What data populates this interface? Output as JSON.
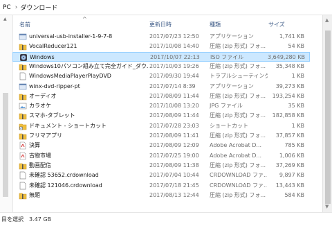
{
  "breadcrumb": {
    "items": [
      "PC",
      "ダウンロード"
    ],
    "separator": "›"
  },
  "columns": {
    "name": "名前",
    "date": "更新日時",
    "type": "種類",
    "size": "サイズ"
  },
  "rows": [
    {
      "name": "universal-usb-installer-1-9-7-8",
      "date": "2017/07/23 12:50",
      "type": "アプリケーション",
      "size": "1,741 KB",
      "icon": "app-icon"
    },
    {
      "name": "VocalReducer121",
      "date": "2017/10/08 14:40",
      "type": "圧縮 (zip 形式) フォ...",
      "size": "54 KB",
      "icon": "zip-icon"
    },
    {
      "name": "Windows",
      "date": "2017/10/07 22:13",
      "type": "ISO ファイル",
      "size": "3,649,280 KB",
      "icon": "iso-icon",
      "selected": true
    },
    {
      "name": "Windows10パソコン組み立て完全ガイド_ダウ...",
      "date": "2017/10/03 19:26",
      "type": "圧縮 (zip 形式) フォ...",
      "size": "35,348 KB",
      "icon": "zip-icon"
    },
    {
      "name": "WindowsMediaPlayerPlayDVD",
      "date": "2017/09/30 19:44",
      "type": "トラブルシューティング...",
      "size": "1 KB",
      "icon": "file-icon"
    },
    {
      "name": "winx-dvd-ripper-pt",
      "date": "2017/07/14 8:39",
      "type": "アプリケーション",
      "size": "39,273 KB",
      "icon": "app-icon"
    },
    {
      "name": "オーディオ",
      "date": "2017/08/09 11:44",
      "type": "圧縮 (zip 形式) フォ...",
      "size": "193,254 KB",
      "icon": "zip-icon"
    },
    {
      "name": "カラオケ",
      "date": "2017/10/08 13:20",
      "type": "JPG ファイル",
      "size": "35 KB",
      "icon": "image-icon"
    },
    {
      "name": "スマホ-タブレット",
      "date": "2017/08/09 11:44",
      "type": "圧縮 (zip 形式) フォ...",
      "size": "182,858 KB",
      "icon": "zip-icon"
    },
    {
      "name": "ドキュメント - ショートカット",
      "date": "2017/07/28 23:03",
      "type": "ショートカット",
      "size": "1 KB",
      "icon": "shortcut-icon"
    },
    {
      "name": "フリマアプリ",
      "date": "2017/08/09 11:41",
      "type": "圧縮 (zip 形式) フォ...",
      "size": "37,857 KB",
      "icon": "zip-icon"
    },
    {
      "name": "決算",
      "date": "2017/08/09 12:09",
      "type": "Adobe Acrobat D...",
      "size": "785 KB",
      "icon": "pdf-icon"
    },
    {
      "name": "古物市場",
      "date": "2017/07/25 19:00",
      "type": "Adobe Acrobat D...",
      "size": "1,006 KB",
      "icon": "pdf-icon"
    },
    {
      "name": "動画配信",
      "date": "2017/08/09 11:38",
      "type": "圧縮 (zip 形式) フォ...",
      "size": "37,269 KB",
      "icon": "zip-icon"
    },
    {
      "name": "未確認 53652.crdownload",
      "date": "2017/07/04 10:44",
      "type": "CRDOWNLOAD ファ...",
      "size": "9,897 KB",
      "icon": "file-icon"
    },
    {
      "name": "未確認 121046.crdownload",
      "date": "2017/07/18 21:45",
      "type": "CRDOWNLOAD ファ...",
      "size": "13,443 KB",
      "icon": "file-icon"
    },
    {
      "name": "無題",
      "date": "2017/08/13 12:44",
      "type": "圧縮 (zip 形式) フォ...",
      "size": "584 KB",
      "icon": "zip-icon"
    }
  ],
  "status": {
    "text": "目を選択",
    "size": "3.47 GB"
  },
  "colors": {
    "selection": "#cce8ff",
    "selection_border": "#99d1ff",
    "header_text": "#3c5a86",
    "zip": "#f0c040"
  }
}
